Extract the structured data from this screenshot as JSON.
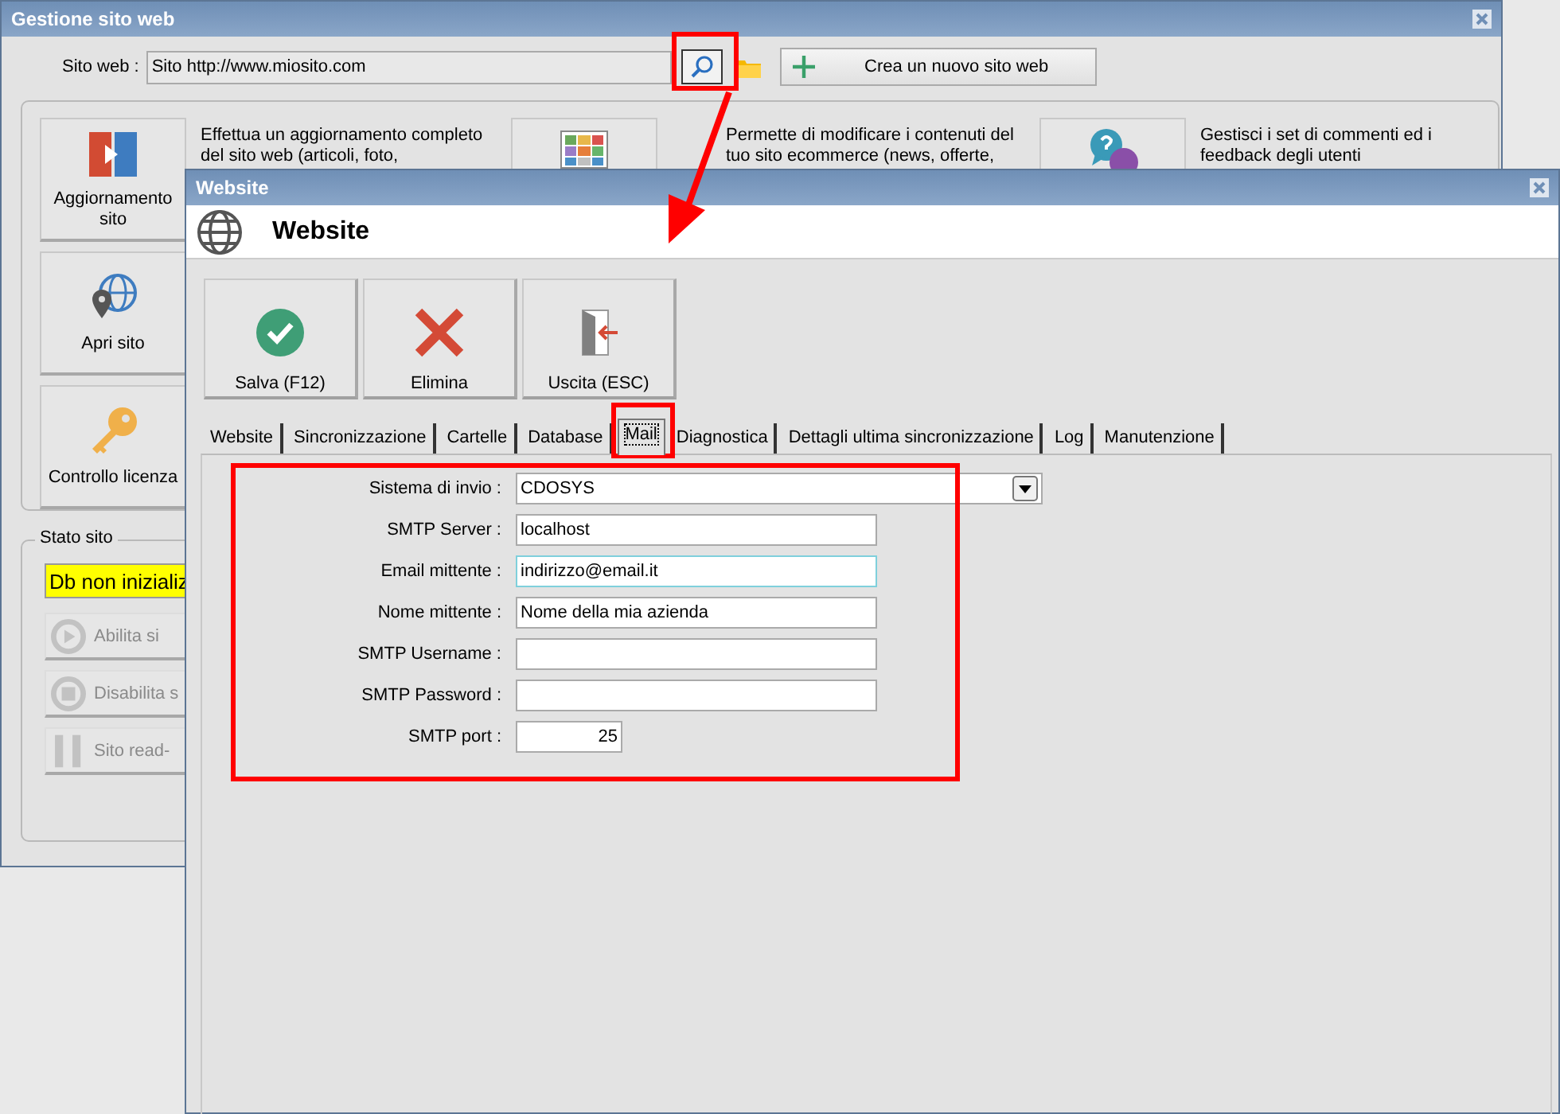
{
  "main_window": {
    "title": "Gestione sito web",
    "site_label": "Sito web :",
    "site_value": "Sito http://www.miosito.com",
    "new_site_button": "Crea un nuovo sito web",
    "tiles": [
      {
        "kind": "update",
        "label": "Aggiornamento sito",
        "description": "Effettua un aggiornamento completo del sito web (articoli, foto,"
      },
      {
        "kind": "grid",
        "description": "Permette di modificare i contenuti del tuo sito ecommerce (news, offerte,"
      },
      {
        "kind": "chat",
        "description": "Gestisci i set di commenti ed i feedback degli utenti"
      }
    ],
    "side_buttons": [
      {
        "kind": "open",
        "label": "Apri sito"
      },
      {
        "kind": "license",
        "label": "Controllo licenza"
      }
    ],
    "status_group": {
      "title": "Stato sito",
      "status": "Db non inizializ",
      "buttons": [
        {
          "kind": "play",
          "label": "Abilita si",
          "disabled": true
        },
        {
          "kind": "stop",
          "label": "Disabilita s",
          "disabled": true
        },
        {
          "kind": "pause",
          "label": "Sito read-",
          "disabled": true
        }
      ]
    }
  },
  "website_window": {
    "title": "Website",
    "header": "Website",
    "toolbar": [
      {
        "kind": "save",
        "label": "Salva (F12)"
      },
      {
        "kind": "delete",
        "label": "Elimina"
      },
      {
        "kind": "exit",
        "label": "Uscita (ESC)"
      }
    ],
    "tabs": [
      {
        "label": "Website",
        "selected": false
      },
      {
        "label": "Sincronizzazione",
        "selected": false
      },
      {
        "label": "Cartelle",
        "selected": false
      },
      {
        "label": "Database",
        "selected": false
      },
      {
        "label": "Mail",
        "selected": true
      },
      {
        "label": "Diagnostica",
        "selected": false
      },
      {
        "label": "Dettagli ultima sincronizzazione",
        "selected": false
      },
      {
        "label": "Log",
        "selected": false
      },
      {
        "label": "Manutenzione",
        "selected": false
      }
    ],
    "fields": [
      {
        "kind": "select",
        "label": "Sistema di invio :",
        "value": "CDOSYS",
        "focused": false
      },
      {
        "kind": "text",
        "label": "SMTP Server :",
        "value": "localhost",
        "focused": false
      },
      {
        "kind": "text",
        "label": "Email mittente :",
        "value": "indirizzo@email.it",
        "focused": true
      },
      {
        "kind": "text",
        "label": "Nome mittente :",
        "value": "Nome della mia azienda",
        "focused": false
      },
      {
        "kind": "text",
        "label": "SMTP Username :",
        "focused": false
      },
      {
        "kind": "text",
        "label": "SMTP Password :",
        "focused": false
      },
      {
        "kind": "number",
        "label": "SMTP port :",
        "value": "25",
        "focused": false
      }
    ]
  }
}
